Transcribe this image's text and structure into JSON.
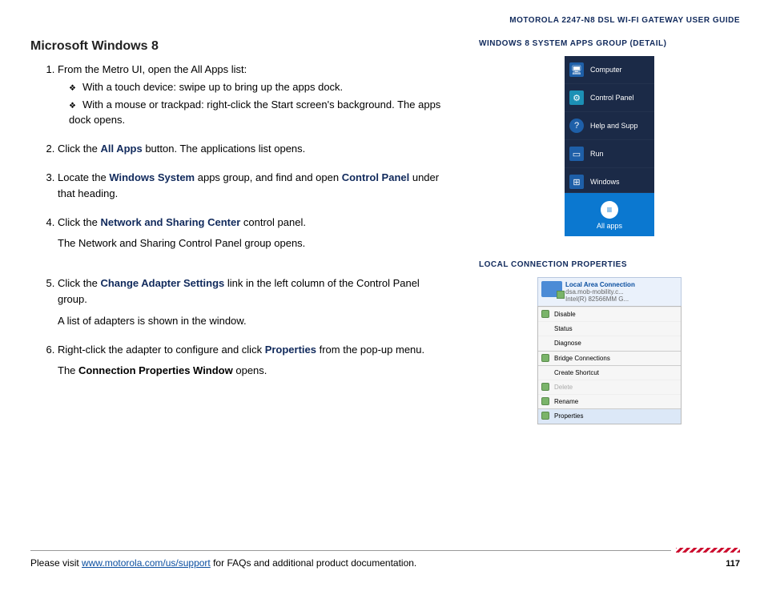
{
  "header": {
    "doc_title": "MOTOROLA 2247-N8 DSL WI-FI GATEWAY USER GUIDE"
  },
  "section": {
    "title": "Microsoft Windows 8"
  },
  "steps": {
    "s1_intro": "From the Metro UI, open the All Apps list:",
    "s1_a": "With a touch device: swipe up to bring up the apps dock.",
    "s1_b": "With a mouse or trackpad: right-click the Start screen's background. The apps dock opens.",
    "s2_a": "Click the ",
    "s2_b": "All Apps",
    "s2_c": " button. The applications list opens.",
    "s3_a": "Locate the ",
    "s3_b": "Windows System",
    "s3_c": " apps group, and find and open ",
    "s3_d": "Control Panel",
    "s3_e": " under that heading.",
    "s4_a": "Click the ",
    "s4_b": "Network and Sharing Center",
    "s4_c": " control panel.",
    "s4_p": "The Network and Sharing Control Panel group opens.",
    "s5_a": "Click the ",
    "s5_b": "Change Adapter Settings",
    "s5_c": " link in the left column of the Control Panel group.",
    "s5_p": "A list of adapters is shown in the window.",
    "s6_a": "Right-click the adapter to configure and click ",
    "s6_b": "Properties",
    "s6_c": " from the pop-up menu.",
    "s6_p_a": "The ",
    "s6_p_b": "Connection Properties Window",
    "s6_p_c": " opens."
  },
  "sidebar": {
    "heading1": "WINDOWS 8 SYSTEM APPS GROUP (DETAIL)",
    "heading2": "LOCAL CONNECTION PROPERTIES",
    "win8": {
      "computer": "Computer",
      "control_panel": "Control Panel",
      "help": "Help and Supp",
      "run": "Run",
      "windows": "Windows",
      "all_apps": "All apps"
    },
    "lcp": {
      "title": "Local Area Connection",
      "sub": "dsa.mob-mobility.c...\nIntel(R) 82566MM G...",
      "disable": "Disable",
      "status": "Status",
      "diagnose": "Diagnose",
      "bridge": "Bridge Connections",
      "shortcut": "Create Shortcut",
      "delete": "Delete",
      "rename": "Rename",
      "properties": "Properties"
    }
  },
  "footer": {
    "pre": "Please visit ",
    "link": "www.motorola.com/us/support",
    "post": " for FAQs and additional product documentation.",
    "page": "117"
  }
}
